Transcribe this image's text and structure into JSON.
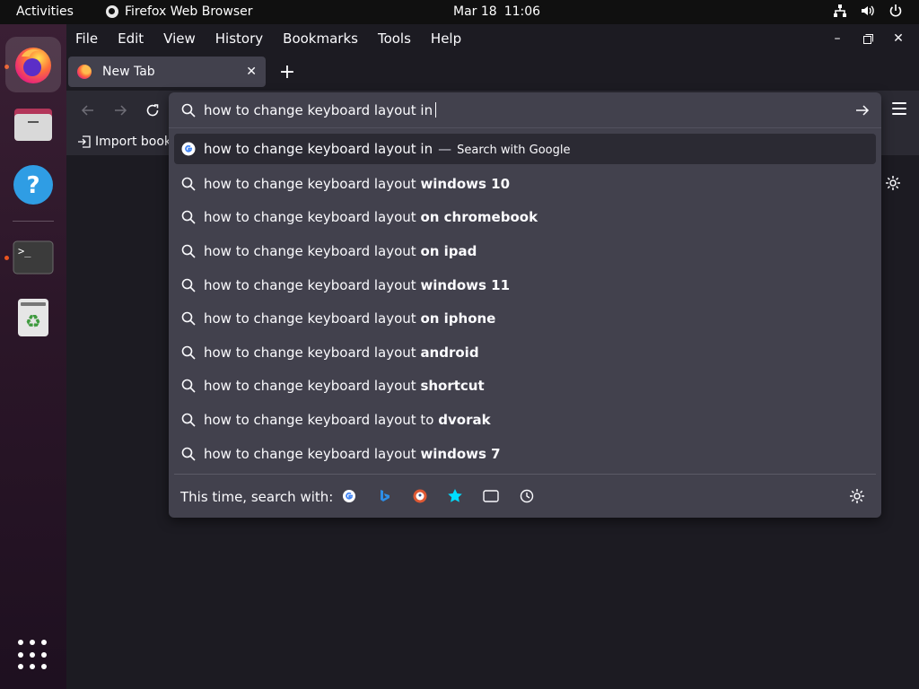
{
  "topbar": {
    "activities": "Activities",
    "app_name": "Firefox Web Browser",
    "date": "Mar 18",
    "time": "11:06",
    "tray_icons": [
      "network-icon",
      "volume-icon",
      "power-icon"
    ]
  },
  "dock": {
    "items": [
      {
        "name": "firefox",
        "icon": "firefox-icon",
        "active": true,
        "running": true
      },
      {
        "name": "files",
        "icon": "folder-icon",
        "active": false,
        "running": false
      },
      {
        "name": "help",
        "icon": "help-icon",
        "active": false,
        "running": false
      },
      {
        "name": "terminal",
        "icon": "terminal-icon",
        "active": false,
        "running": true
      },
      {
        "name": "trash",
        "icon": "trash-icon",
        "active": false,
        "running": false
      }
    ],
    "show_apps_icon": "app-grid-icon",
    "running_dot_color": "#e95420"
  },
  "menubar": {
    "items": [
      "File",
      "Edit",
      "View",
      "History",
      "Bookmarks",
      "Tools",
      "Help"
    ]
  },
  "tabs": [
    {
      "label": "New Tab",
      "active": true
    }
  ],
  "bookmarks_toolbar": {
    "import_label": "Import book"
  },
  "urlbar": {
    "value": "how to change keyboard layout in",
    "suggestions": [
      {
        "prefix": "how to change keyboard layout in",
        "bold": "",
        "action": "Search with Google",
        "icon": "google-icon"
      },
      {
        "prefix": "how to change keyboard layout ",
        "bold": "windows 10",
        "icon": "search-icon"
      },
      {
        "prefix": "how to change keyboard layout ",
        "bold": "on chromebook",
        "icon": "search-icon"
      },
      {
        "prefix": "how to change keyboard layout ",
        "bold": "on ipad",
        "icon": "search-icon"
      },
      {
        "prefix": "how to change keyboard layout ",
        "bold": "windows 11",
        "icon": "search-icon"
      },
      {
        "prefix": "how to change keyboard layout ",
        "bold": "on iphone",
        "icon": "search-icon"
      },
      {
        "prefix": "how to change keyboard layout ",
        "bold": "android",
        "icon": "search-icon"
      },
      {
        "prefix": "how to change keyboard layout ",
        "bold": "shortcut",
        "icon": "search-icon"
      },
      {
        "prefix": "how to change keyboard layout to ",
        "bold": "dvorak",
        "icon": "search-icon"
      },
      {
        "prefix": "how to change keyboard layout ",
        "bold": "windows 7",
        "icon": "search-icon"
      }
    ],
    "one_off_label": "This time, search with:",
    "engines": [
      "google-icon",
      "bing-icon",
      "duckduckgo-icon",
      "bookmarks-star-icon",
      "tabs-icon",
      "history-icon"
    ]
  },
  "colors": {
    "panel_bg": "#42414d",
    "window_bg": "#1c1b22",
    "text": "#fbfbfe"
  }
}
